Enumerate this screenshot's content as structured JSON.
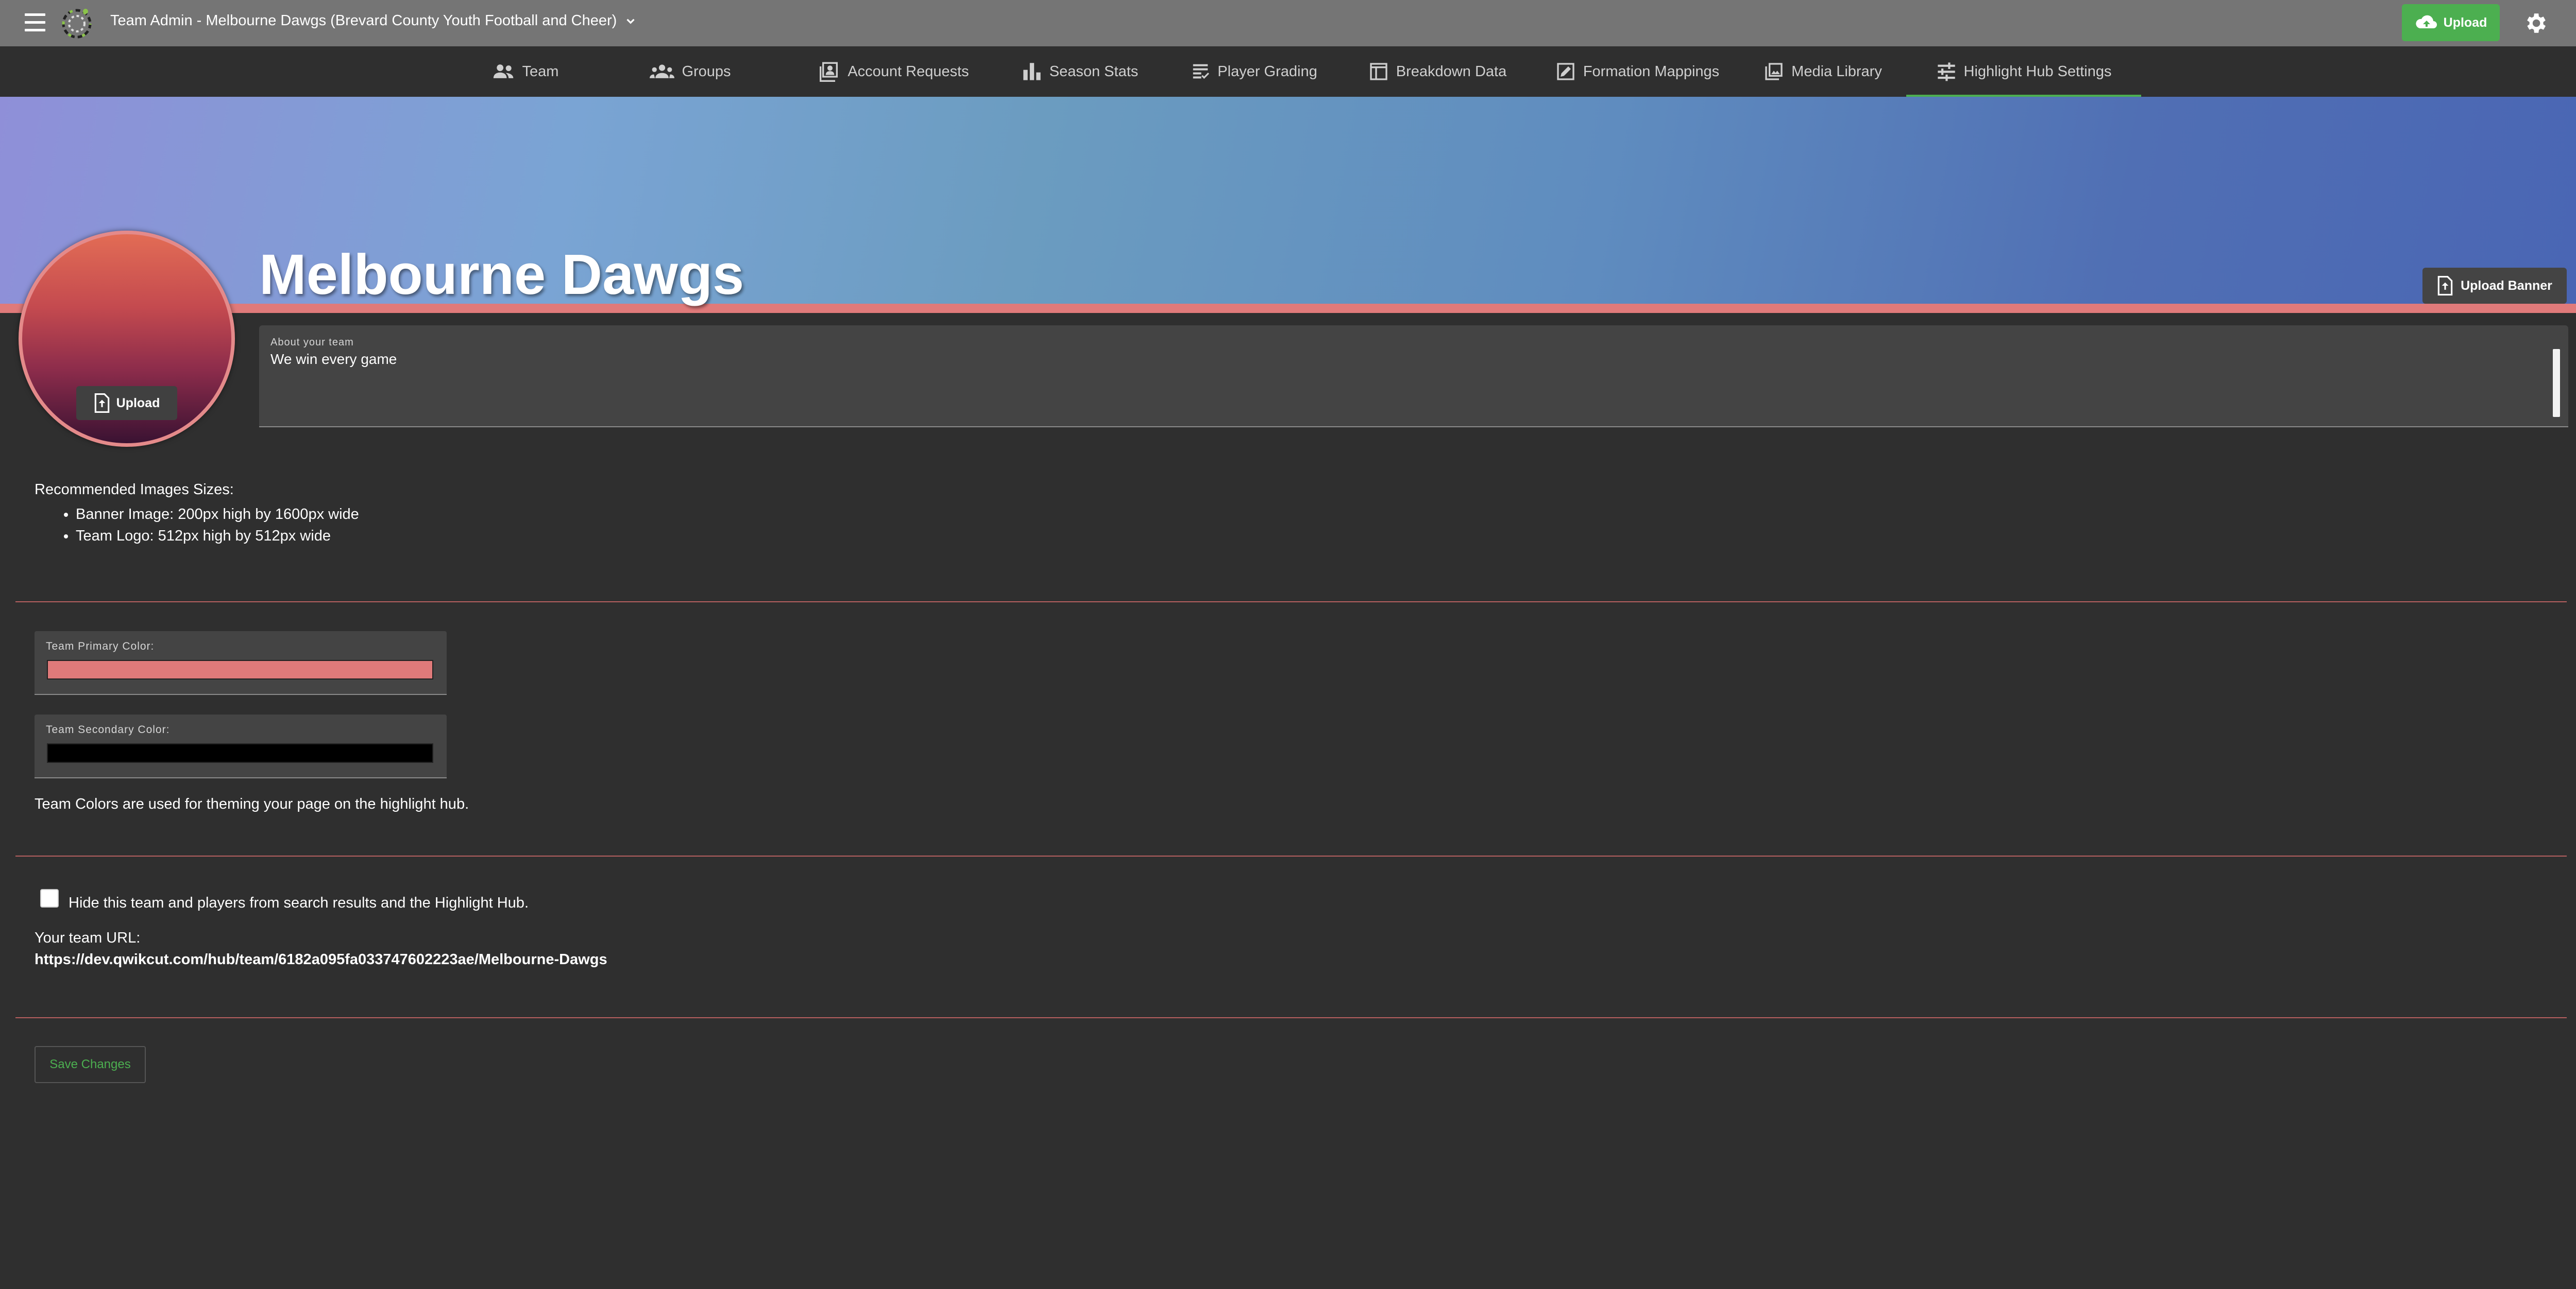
{
  "header": {
    "title": "Team Admin - Melbourne Dawgs (Brevard County Youth Football and Cheer)",
    "upload_label": "Upload"
  },
  "tabs": [
    {
      "label": "Team",
      "icon": "people-icon"
    },
    {
      "label": "Groups",
      "icon": "groups-icon"
    },
    {
      "label": "Account Requests",
      "icon": "account-box-icon"
    },
    {
      "label": "Season Stats",
      "icon": "bar-chart-icon"
    },
    {
      "label": "Player Grading",
      "icon": "grading-icon"
    },
    {
      "label": "Breakdown Data",
      "icon": "table-icon"
    },
    {
      "label": "Formation Mappings",
      "icon": "draw-icon"
    },
    {
      "label": "Media Library",
      "icon": "photo-library-icon"
    },
    {
      "label": "Highlight Hub Settings",
      "icon": "tune-icon",
      "active": true
    }
  ],
  "banner": {
    "team_name": "Melbourne Dawgs",
    "upload_banner_label": "Upload Banner"
  },
  "logo": {
    "upload_label": "Upload"
  },
  "about": {
    "label": "About your team",
    "value": "We win every game"
  },
  "recommendations": {
    "title": "Recommended Images Sizes:",
    "items": [
      "Banner Image: 200px high by 1600px wide",
      "Team Logo: 512px high by 512px wide"
    ]
  },
  "colors": {
    "primary_label": "Team Primary Color:",
    "primary_value": "#e07a7a",
    "secondary_label": "Team Secondary Color:",
    "secondary_value": "#000000",
    "note": "Team Colors are used for theming your page on the highlight hub."
  },
  "visibility": {
    "hide_label": "Hide this team and players from search results and the Highlight Hub.",
    "hide_checked": false,
    "url_label": "Your team URL:",
    "url_value": "https://dev.qwikcut.com/hub/team/6182a095fa033747602223ae/Melbourne-Dawgs"
  },
  "actions": {
    "save_label": "Save Changes"
  },
  "theme": {
    "appbar": "#757575",
    "accent_green": "#4caf50",
    "background": "#2f2f2f"
  }
}
